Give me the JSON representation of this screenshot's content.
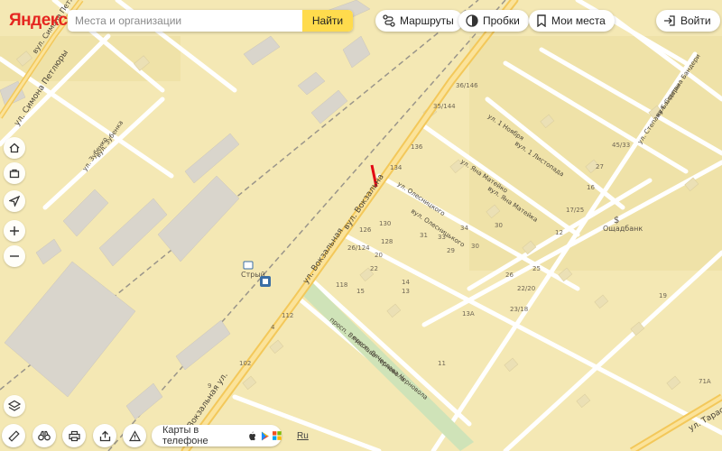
{
  "header": {
    "logo": "Яндекс",
    "search_placeholder": "Места и организации",
    "search_button": "Найти",
    "routes": "Маршруты",
    "traffic": "Пробки",
    "my_places": "Мои места",
    "login": "Войти"
  },
  "map": {
    "street_labels": [
      "ул. Симона Петлюры",
      "вул. Симона Петлюры",
      "ул. Зубенко",
      "вул. Зубенка",
      "Вокзальная ул.",
      "ул. Вокзальная",
      "вул. Вокзальна",
      "ул. Олесницкого",
      "вул. Олесницького",
      "ул. Яна Матейко",
      "вул. Яна Матейка",
      "ул. 1 Ноября",
      "вул. 1 Листопада",
      "ул. Степана Бандеры",
      "вул. Степана Бандери",
      "просп. Вячеслава Черновола",
      "просп. Вячеслава Черновола",
      "ул. Тарас"
    ],
    "place_labels": [
      "Стрый",
      "Ощадбанк"
    ],
    "house_numbers": [
      "36/146",
      "35/144",
      "136",
      "134",
      "130",
      "128",
      "126",
      "26/124",
      "118",
      "112",
      "102",
      "15",
      "14",
      "13",
      "31",
      "30",
      "29",
      "33",
      "34",
      "27",
      "26",
      "25",
      "22",
      "20",
      "13А",
      "23/18",
      "22/20",
      "17/25",
      "45/33",
      "71А",
      "9",
      "4",
      "11",
      "19",
      "12",
      "16",
      "30"
    ]
  },
  "controls": {
    "phone_promo": "Карты в телефоне",
    "language": "Ru"
  }
}
